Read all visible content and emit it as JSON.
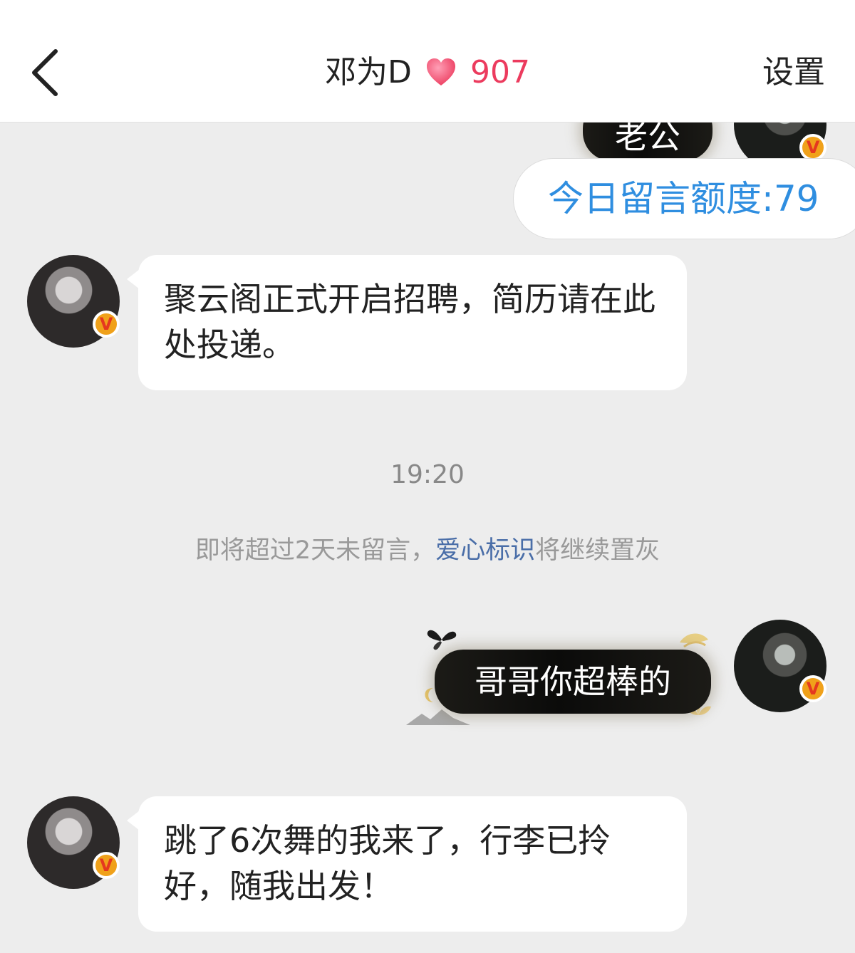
{
  "header": {
    "back_icon": "chevron-left-icon",
    "title_name": "邓为D",
    "heart_icon": "heart-icon",
    "heart_color": "#ec3b5e",
    "score": "907",
    "settings_label": "设置"
  },
  "messages": {
    "top_partial_text": "老公",
    "quota_text": "今日留言额度:79",
    "msg1": "聚云阁正式开启招聘，简历请在此处投递。",
    "timestamp": "19:20",
    "notice_before": "即将超过2天未留言，",
    "notice_link": "爱心标识",
    "notice_after": "将继续置灰",
    "my_msg": "哥哥你超棒的",
    "msg2": "跳了6次舞的我来了，行李已拎好，随我出发！"
  },
  "badge_letter": "V",
  "colors": {
    "accent_blue": "#2f8ee0",
    "badge": "#f0a11a"
  }
}
